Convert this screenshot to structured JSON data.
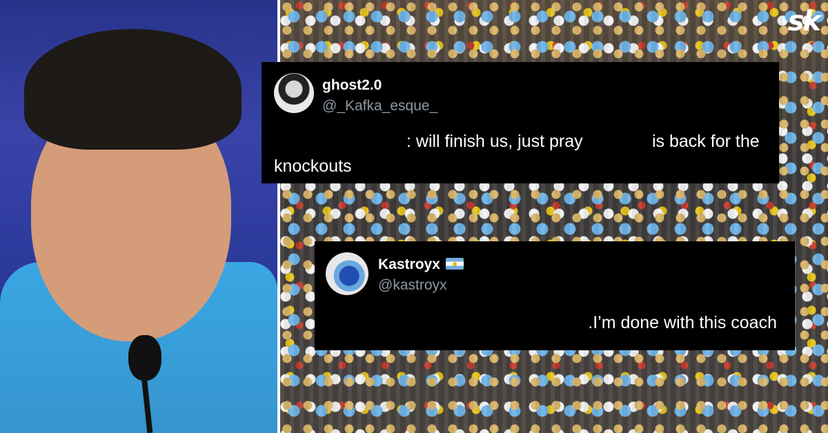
{
  "brand": {
    "logo_text": "sk"
  },
  "tweets": [
    {
      "display_name": "ghost2.0",
      "handle": "@_Kafka_esque_",
      "text_parts": [
        ": will finish us, just pray",
        "is back for the",
        "knockouts"
      ],
      "has_flag": false
    },
    {
      "display_name": "Kastroyx",
      "handle": "@kastroyx",
      "text": ".I’m done with this coach",
      "has_flag": true,
      "flag": "argentina"
    }
  ],
  "colors": {
    "tweet_bg": "#000000",
    "name_color": "#ffffff",
    "handle_color": "#8b98a5",
    "shirt_color": "#3aa6e3"
  }
}
